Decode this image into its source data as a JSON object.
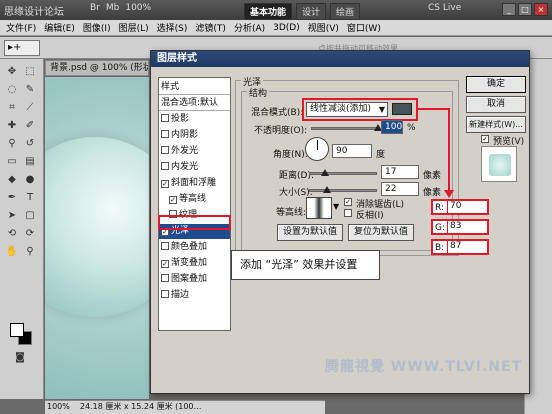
{
  "app": {
    "logo_text": "思缘设计论坛",
    "top_tools": [
      "Br",
      "Mb",
      "100%"
    ],
    "workspace_tabs": [
      "基本功能",
      "设计",
      "绘画"
    ],
    "cs_live": "CS Live",
    "window_buttons": [
      "_",
      "□",
      "×"
    ]
  },
  "menubar": [
    "文件(F)",
    "编辑(E)",
    "图像(I)",
    "图层(L)",
    "选择(S)",
    "滤镜(T)",
    "分析(A)",
    "3D(D)",
    "视图(V)",
    "窗口(W)"
  ],
  "options_bar": {
    "tool_preset": "▸+",
    "hint": "点按并拖动可移动效果"
  },
  "document": {
    "tab_label": "背景.psd @ 100% (形状",
    "zoom": "100%",
    "doc_size": "24.18 厘米 x 15.24 厘米 (100…"
  },
  "dialog": {
    "title": "图层样式",
    "styles_header": "样式",
    "blend_options": "混合选项:默认",
    "styles": [
      {
        "label": "投影",
        "checked": false,
        "sub": false
      },
      {
        "label": "内阴影",
        "checked": false,
        "sub": false
      },
      {
        "label": "外发光",
        "checked": false,
        "sub": false
      },
      {
        "label": "内发光",
        "checked": false,
        "sub": false
      },
      {
        "label": "斜面和浮雕",
        "checked": true,
        "sub": false
      },
      {
        "label": "等高线",
        "checked": true,
        "sub": true
      },
      {
        "label": "纹理",
        "checked": false,
        "sub": true
      },
      {
        "label": "光泽",
        "checked": true,
        "sub": false,
        "selected": true
      },
      {
        "label": "颜色叠加",
        "checked": false,
        "sub": false
      },
      {
        "label": "渐变叠加",
        "checked": true,
        "sub": false
      },
      {
        "label": "图案叠加",
        "checked": false,
        "sub": false
      },
      {
        "label": "描边",
        "checked": false,
        "sub": false
      }
    ],
    "satin": {
      "group_title": "光泽",
      "structure_title": "结构",
      "blend_mode_label": "混合模式(B):",
      "blend_mode_value": "线性减淡(添加)",
      "opacity_label": "不透明度(O):",
      "opacity_value": "100",
      "opacity_unit": "%",
      "angle_label": "角度(N):",
      "angle_value": "90",
      "angle_unit": "度",
      "distance_label": "距离(D):",
      "distance_value": "17",
      "distance_unit": "像素",
      "size_label": "大小(S):",
      "size_value": "22",
      "size_unit": "像素",
      "contour_label": "等高线:",
      "antialias_label": "消除锯齿(L)",
      "antialias_checked": true,
      "invert_label": "反相(I)",
      "invert_checked": false,
      "make_default": "设置为默认值",
      "reset_default": "复位为默认值"
    },
    "buttons": {
      "ok": "确定",
      "cancel": "取消",
      "new_style": "新建样式(W)...",
      "preview_label": "预览(V)",
      "preview_checked": true
    }
  },
  "color": {
    "label_r": "R:",
    "value_r": "70",
    "label_g": "G:",
    "value_g": "83",
    "label_b": "B:",
    "value_b": "87",
    "swatch_hex": "#465357"
  },
  "callout_text": "添加 “光泽” 效果并设置",
  "watermark": "腾龍視覺 WWW.TLVI.NET"
}
